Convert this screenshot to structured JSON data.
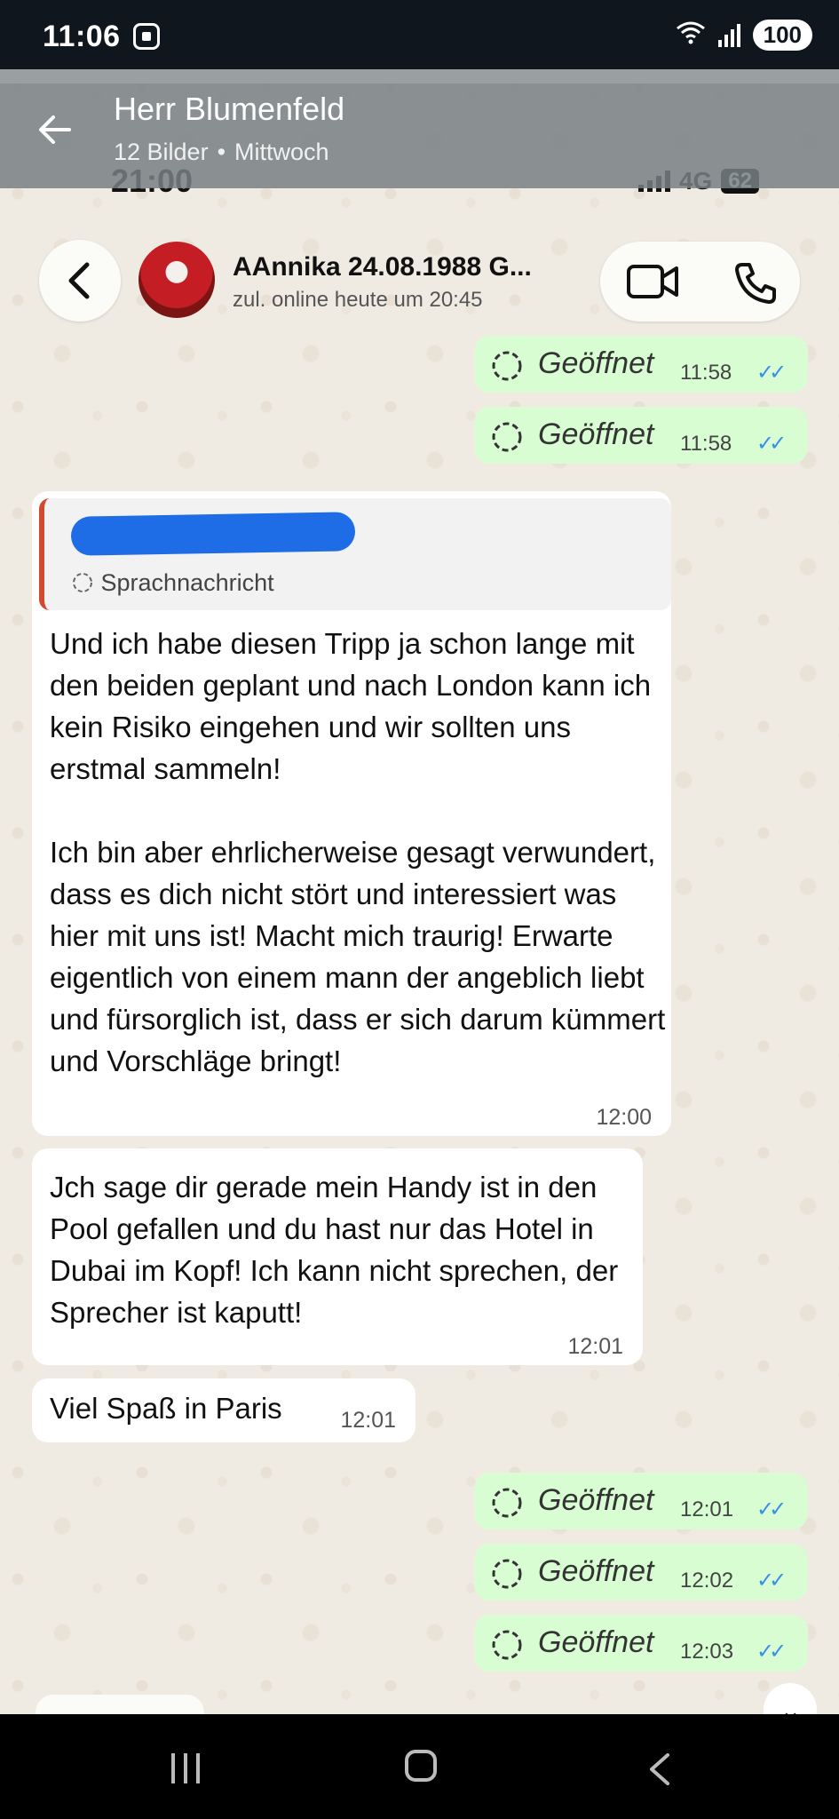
{
  "status_bar": {
    "time": "11:06",
    "battery": "100"
  },
  "gallery_header": {
    "title": "Herr Blumenfeld",
    "count": "12 Bilder",
    "separator": "•",
    "day": "Mittwoch"
  },
  "inner_status": {
    "time": "21:00",
    "network": "4G",
    "battery": "62"
  },
  "chat_header": {
    "contact_name": "AAnnika 24.08.1988 G...",
    "last_seen": "zul. online heute um 20:45"
  },
  "messages": [
    {
      "type": "out",
      "label": "Geöffnet",
      "time": "11:58"
    },
    {
      "type": "out",
      "label": "Geöffnet",
      "time": "11:58"
    },
    {
      "type": "in",
      "quote_label": "Sprachnachricht",
      "paragraph1": "Und ich habe diesen Tripp ja schon lange mit den beiden geplant und nach London kann ich kein Risiko eingehen und wir sollten uns erstmal sammeln!",
      "paragraph2": "Ich bin aber ehrlicherweise gesagt verwundert, dass es dich nicht stört und interessiert was hier mit uns ist! Macht mich traurig! Erwarte eigentlich von einem mann der angeblich liebt und fürsorglich ist, dass er sich darum kümmert und Vorschläge bringt!",
      "time": "12:00"
    },
    {
      "type": "in",
      "text": "Jch sage dir gerade mein Handy ist in den Pool gefallen und du hast nur das Hotel in Dubai im Kopf! Ich kann nicht sprechen, der Sprecher ist kaputt!",
      "time": "12:01"
    },
    {
      "type": "in",
      "text": "Viel Spaß in Paris",
      "time": "12:01"
    },
    {
      "type": "out",
      "label": "Geöffnet",
      "time": "12:01"
    },
    {
      "type": "out",
      "label": "Geöffnet",
      "time": "12:02"
    },
    {
      "type": "out",
      "label": "Geöffnet",
      "time": "12:03"
    }
  ],
  "colors": {
    "outgoing": "#d9fdd3",
    "incoming": "#ffffff",
    "read_tick": "#3a8ee6",
    "wallpaper": "#efeae2"
  }
}
